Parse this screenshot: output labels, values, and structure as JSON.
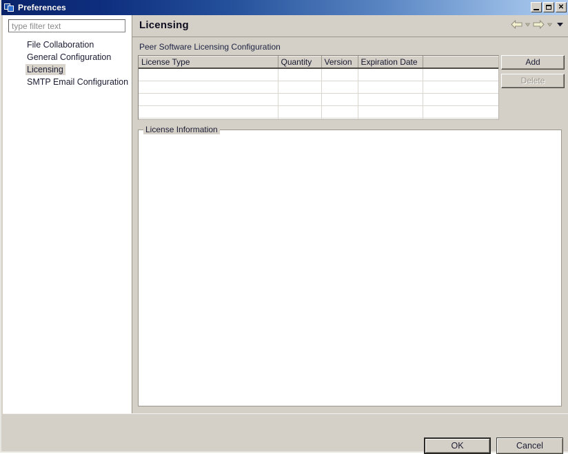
{
  "window": {
    "title": "Preferences",
    "icon": "cascading-windows-icon",
    "controls": {
      "minimize": "_",
      "maximize": "□",
      "close": "✕"
    },
    "titlebar_gradient_from": "#0a246a",
    "titlebar_gradient_to": "#b0cdf0"
  },
  "sidebar": {
    "filter": {
      "value": "",
      "placeholder": "type filter text"
    },
    "items": [
      {
        "label": "File Collaboration",
        "selected": false
      },
      {
        "label": "General Configuration",
        "selected": false
      },
      {
        "label": "Licensing",
        "selected": true
      },
      {
        "label": "SMTP Email Configuration",
        "selected": false
      }
    ]
  },
  "page": {
    "title": "Licensing",
    "subtitle": "Peer Software Licensing Configuration",
    "nav": {
      "back": "back-arrow",
      "back_menu": "back-dropdown",
      "forward": "forward-arrow",
      "forward_menu": "forward-dropdown",
      "view_menu": "view-menu"
    },
    "table": {
      "columns": [
        "License Type",
        "Quantity",
        "Version",
        "Expiration Date",
        ""
      ],
      "rows": [
        [
          "",
          "",
          "",
          "",
          ""
        ],
        [
          "",
          "",
          "",
          "",
          ""
        ],
        [
          "",
          "",
          "",
          "",
          ""
        ],
        [
          "",
          "",
          "",
          "",
          ""
        ],
        [
          "",
          "",
          "",
          "",
          ""
        ]
      ]
    },
    "buttons": {
      "add": "Add",
      "delete": "Delete",
      "delete_enabled": false
    },
    "group": {
      "legend": "License Information",
      "content": ""
    }
  },
  "footer": {
    "ok": "OK",
    "cancel": "Cancel"
  }
}
